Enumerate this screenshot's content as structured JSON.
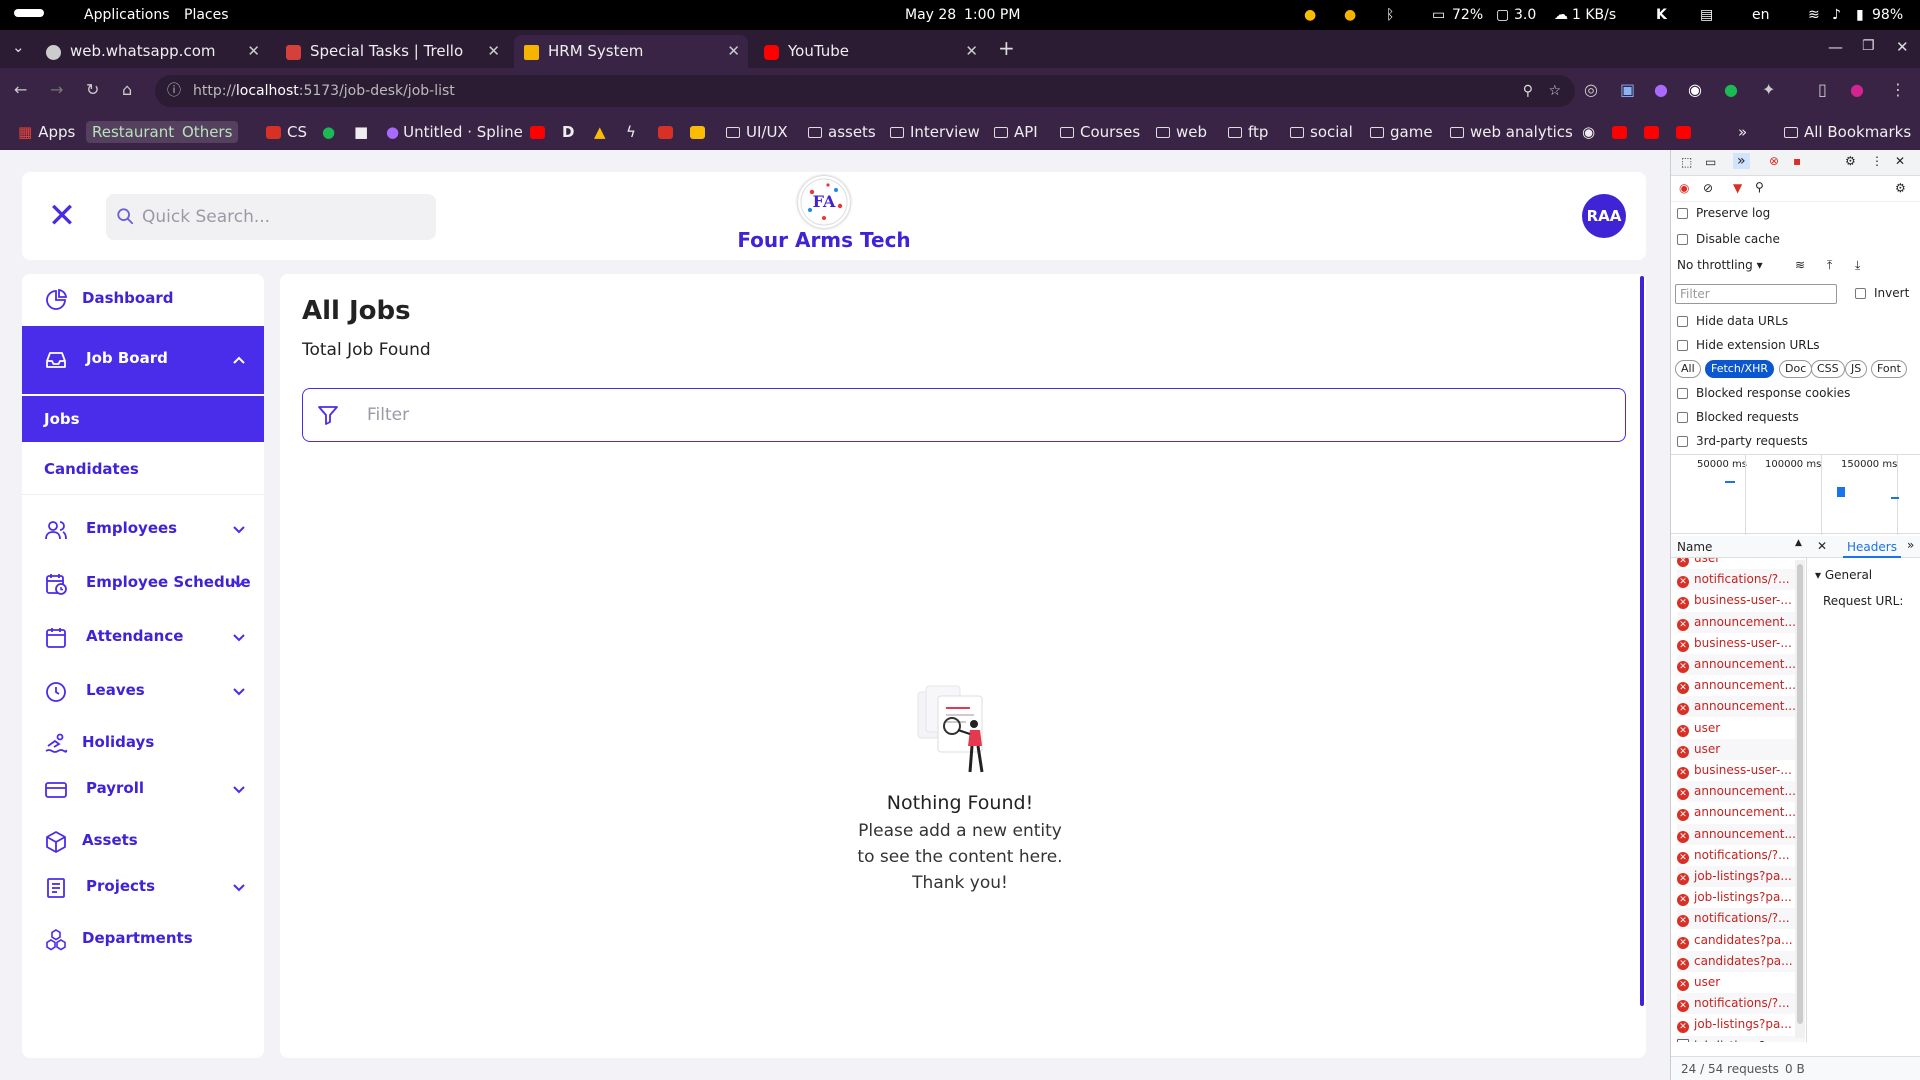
{
  "os": {
    "applications": "Applications",
    "places": "Places",
    "date": "May 28",
    "time": "1:00 PM",
    "battery_small": "72%",
    "load": "3.0",
    "net": "1 KB/s",
    "lang": "en",
    "battery": "98%"
  },
  "browser": {
    "tabs": [
      {
        "title": "web.whatsapp.com",
        "color": "#cccccc"
      },
      {
        "title": "Special Tasks | Trello",
        "color": "#d6403b"
      },
      {
        "title": "HRM System",
        "color": "#f4b400"
      },
      {
        "title": "YouTube",
        "color": "#ff0000"
      }
    ],
    "url_prefix": "http://",
    "url_host": "localhost",
    "url_rest": ":5173/job-desk/job-list",
    "bookmarks": {
      "apps": "Apps",
      "restaurant": "Restaurant",
      "others": "Others",
      "cs": "CS",
      "spline": "Untitled · Spline",
      "uiux": "UI/UX",
      "assets": "assets",
      "interview": "Interview",
      "api": "API",
      "courses": "Courses",
      "web": "web",
      "ftp": "ftp",
      "social": "social",
      "game": "game",
      "web_analytics": "web analytics",
      "more": "»",
      "all": "All Bookmarks"
    }
  },
  "app": {
    "search_placeholder": "Quick Search...",
    "brand": "Four Arms Tech",
    "avatar": "RAA",
    "nav": {
      "dashboard": "Dashboard",
      "job_board": "Job Board",
      "jobs": "Jobs",
      "candidates": "Candidates",
      "employees": "Employees",
      "employee_schedule": "Employee Schedule",
      "attendance": "Attendance",
      "leaves": "Leaves",
      "holidays": "Holidays",
      "payroll": "Payroll",
      "assets": "Assets",
      "projects": "Projects",
      "departments": "Departments"
    },
    "page": {
      "title": "All Jobs",
      "subtitle": "Total Job Found",
      "filter_placeholder": "Filter",
      "empty_title": "Nothing Found!",
      "empty_message": "Please add a new entity to see the content here. Thank you!"
    }
  },
  "devtools": {
    "preserve_log": "Preserve log",
    "disable_cache": "Disable cache",
    "throttling": "No throttling",
    "filter_placeholder": "Filter",
    "invert": "Invert",
    "hide_data_urls": "Hide data URLs",
    "hide_extension_urls": "Hide extension URLs",
    "types": [
      "All",
      "Fetch/XHR",
      "Doc",
      "CSS",
      "JS",
      "Font"
    ],
    "blocked_cookies": "Blocked response cookies",
    "blocked_requests": "Blocked requests",
    "third_party": "3rd-party requests",
    "timeline": [
      "50000 ms",
      "100000 ms",
      "150000 ms"
    ],
    "name_col": "Name",
    "headers_tab": "Headers",
    "general": "General",
    "request_url": "Request URL:",
    "requests": [
      "user",
      "notifications/?...",
      "business-user-...",
      "announcement...",
      "business-user-...",
      "announcement...",
      "announcement...",
      "announcement...",
      "user",
      "user",
      "business-user-...",
      "announcement...",
      "announcement...",
      "announcement...",
      "notifications/?...",
      "job-listings?pa...",
      "job-listings?pa...",
      "notifications/?...",
      "candidates?pa...",
      "candidates?pa...",
      "user",
      "notifications/?...",
      "job-listings?pa...",
      "job-listings?pa..."
    ],
    "summary": "24 / 54 requests",
    "transferred": "0 B"
  }
}
